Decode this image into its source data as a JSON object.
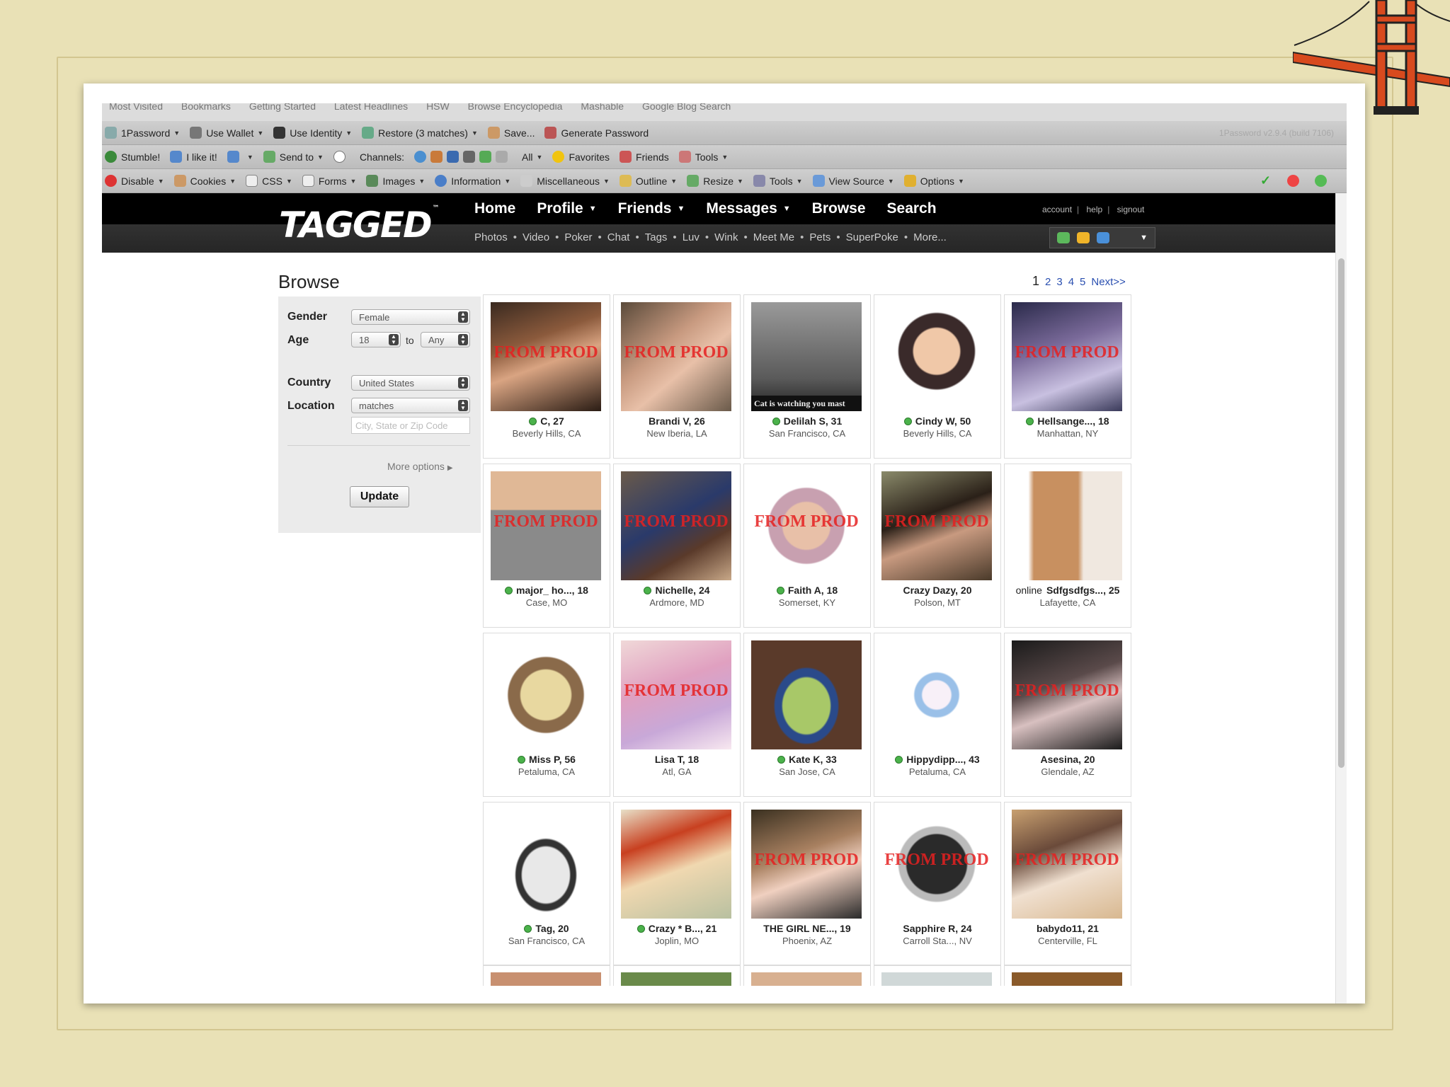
{
  "browser": {
    "tab_strip": [
      "Most Visited",
      "Bookmarks",
      "Getting Started",
      "Latest Headlines",
      "HSW",
      "Browse Encyclopedia",
      "Mashable",
      "Google Blog Search"
    ],
    "toolbar1": {
      "items": [
        "1Password",
        "Use Wallet",
        "Use Identity",
        "Restore (3 matches)",
        "Save...",
        "Generate Password"
      ],
      "version": "1Password v2.9.4 (build 7106)"
    },
    "toolbar2": {
      "items": [
        "Stumble!",
        "I like it!",
        "Send to",
        "Channels:",
        "All",
        "Favorites",
        "Friends",
        "Tools"
      ]
    },
    "toolbar3": {
      "items": [
        "Disable",
        "Cookies",
        "CSS",
        "Forms",
        "Images",
        "Information",
        "Miscellaneous",
        "Outline",
        "Resize",
        "Tools",
        "View Source",
        "Options"
      ]
    }
  },
  "site": {
    "logo": "TAGGED",
    "logo_tm": "™",
    "nav": [
      "Home",
      "Profile",
      "Friends",
      "Messages",
      "Browse",
      "Search"
    ],
    "subnav": [
      "Photos",
      "Video",
      "Poker",
      "Chat",
      "Tags",
      "Luv",
      "Wink",
      "Meet Me",
      "Pets",
      "SuperPoke",
      "More..."
    ],
    "account": [
      "account",
      "help",
      "signout"
    ]
  },
  "page": {
    "title": "Browse",
    "pager": {
      "current": "1",
      "pages": [
        "2",
        "3",
        "4",
        "5"
      ],
      "next": "Next>>"
    }
  },
  "filters": {
    "gender_label": "Gender",
    "gender_value": "Female",
    "age_label": "Age",
    "age_min": "18",
    "age_to": "to",
    "age_max": "Any",
    "country_label": "Country",
    "country_value": "United States",
    "location_label": "Location",
    "location_value": "matches",
    "zip_placeholder": "City, State or Zip Code",
    "more_options": "More options",
    "update": "Update"
  },
  "watermark": "FROM PROD",
  "online_text": "online",
  "cat_caption": "Cat is watching you mast",
  "profiles": [
    {
      "name": "C, 27",
      "loc": "Beverly Hills, CA",
      "online": true,
      "stamp": true
    },
    {
      "name": "Brandi V, 26",
      "loc": "New Iberia, LA",
      "online": false,
      "stamp": true
    },
    {
      "name": "Delilah S, 31",
      "loc": "San Francisco, CA",
      "online": true,
      "stamp": false
    },
    {
      "name": "Cindy W, 50",
      "loc": "Beverly Hills, CA",
      "online": true,
      "stamp": false
    },
    {
      "name": "Hellsange..., 18",
      "loc": "Manhattan, NY",
      "online": true,
      "stamp": true
    },
    {
      "name": "major_ ho..., 18",
      "loc": "Case, MO",
      "online": true,
      "stamp": true
    },
    {
      "name": "Nichelle, 24",
      "loc": "Ardmore, MD",
      "online": true,
      "stamp": true
    },
    {
      "name": "Faith A, 18",
      "loc": "Somerset, KY",
      "online": true,
      "stamp": true
    },
    {
      "name": "Crazy Dazy, 20",
      "loc": "Polson, MT",
      "online": false,
      "stamp": true
    },
    {
      "name": "Sdfgsdfgs..., 25",
      "loc": "Lafayette, CA",
      "online": false,
      "stamp": false,
      "online_text": true
    },
    {
      "name": "Miss P, 56",
      "loc": "Petaluma, CA",
      "online": true,
      "stamp": false
    },
    {
      "name": "Lisa T, 18",
      "loc": "Atl, GA",
      "online": false,
      "stamp": true
    },
    {
      "name": "Kate K, 33",
      "loc": "San Jose, CA",
      "online": true,
      "stamp": false
    },
    {
      "name": "Hippydipp..., 43",
      "loc": "Petaluma, CA",
      "online": true,
      "stamp": false
    },
    {
      "name": "Asesina, 20",
      "loc": "Glendale, AZ",
      "online": false,
      "stamp": true
    },
    {
      "name": "Tag, 20",
      "loc": "San Francisco, CA",
      "online": true,
      "stamp": false
    },
    {
      "name": "Crazy * B..., 21",
      "loc": "Joplin, MO",
      "online": true,
      "stamp": false
    },
    {
      "name": "THE GIRL NE..., 19",
      "loc": "Phoenix, AZ",
      "online": false,
      "stamp": true
    },
    {
      "name": "Sapphire R, 24",
      "loc": "Carroll Sta..., NV",
      "online": false,
      "stamp": true
    },
    {
      "name": "babydo11, 21",
      "loc": "Centerville, FL",
      "online": false,
      "stamp": true
    }
  ],
  "colors": {
    "nav_bg": "#000000",
    "link": "#2a4fb0",
    "watermark": "#e62020",
    "online_dot": "#4bb24b",
    "page_bg": "#e9e1b6"
  }
}
